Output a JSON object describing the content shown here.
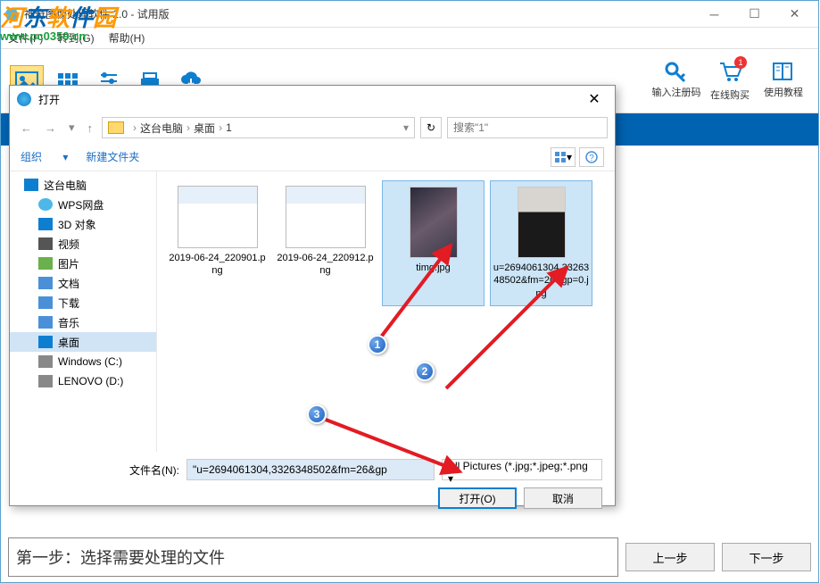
{
  "app": {
    "title": "神奇图像处理软件 2.0 - 试用版",
    "watermark_text": "河东软件园",
    "watermark_url": "www.pc0359.cn"
  },
  "menubar": {
    "file": "文件(F)",
    "goto": "转到(G)",
    "help": "帮助(H)"
  },
  "toolbar_right": {
    "regcode": "输入注册码",
    "buy": "在线购买",
    "tutorial": "使用教程",
    "cart_badge": "1"
  },
  "bottom": {
    "message": "第一步：选择需要处理的文件",
    "prev": "上一步",
    "next": "下一步"
  },
  "dialog": {
    "title": "打开",
    "breadcrumb": {
      "root": "这台电脑",
      "folder1": "桌面",
      "folder2": "1"
    },
    "search_placeholder": "搜索\"1\"",
    "organize": "组织",
    "new_folder": "新建文件夹",
    "sidebar": [
      {
        "label": "这台电脑",
        "icon": "sb-pc",
        "level": 1
      },
      {
        "label": "WPS网盘",
        "icon": "sb-cloud",
        "level": 2
      },
      {
        "label": "3D 对象",
        "icon": "sb-3d",
        "level": 2
      },
      {
        "label": "视频",
        "icon": "sb-video",
        "level": 2
      },
      {
        "label": "图片",
        "icon": "sb-pic",
        "level": 2
      },
      {
        "label": "文档",
        "icon": "sb-doc",
        "level": 2
      },
      {
        "label": "下载",
        "icon": "sb-down",
        "level": 2
      },
      {
        "label": "音乐",
        "icon": "sb-music",
        "level": 2
      },
      {
        "label": "桌面",
        "icon": "sb-desktop",
        "level": 2,
        "selected": true
      },
      {
        "label": "Windows (C:)",
        "icon": "sb-disk",
        "level": 2
      },
      {
        "label": "LENOVO (D:)",
        "icon": "sb-disk",
        "level": 2
      }
    ],
    "files": [
      {
        "name": "2019-06-24_220901.png",
        "thumb": "screenshot",
        "selected": false
      },
      {
        "name": "2019-06-24_220912.png",
        "thumb": "screenshot",
        "selected": false
      },
      {
        "name": "timg.jpg",
        "thumb": "photo1",
        "selected": true
      },
      {
        "name": "u=2694061304,3326348502&fm=26&gp=0.jpg",
        "thumb": "photo2",
        "selected": true
      }
    ],
    "filename_label": "文件名(N):",
    "filename_value": "\"u=2694061304,3326348502&fm=26&gp",
    "filter": "All Pictures (*.jpg;*.jpeg;*.png",
    "open_btn": "打开(O)",
    "cancel_btn": "取消"
  },
  "annotations": {
    "n1": "1",
    "n2": "2",
    "n3": "3"
  }
}
